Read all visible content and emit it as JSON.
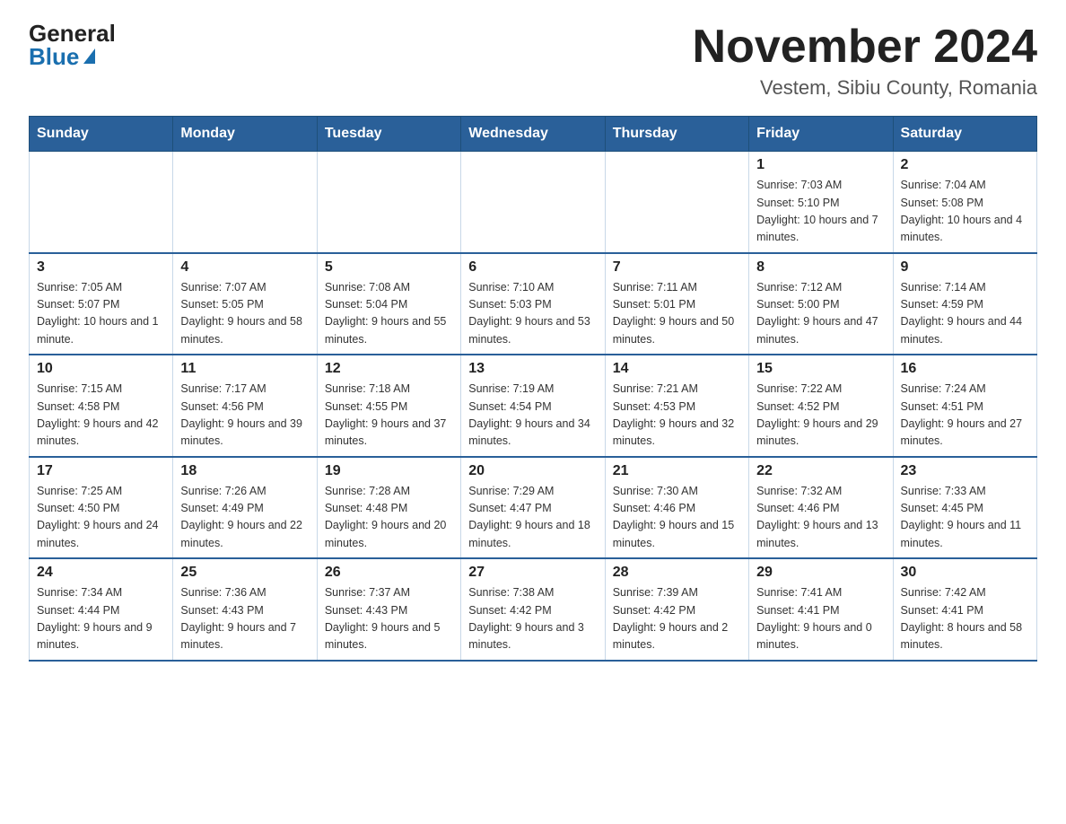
{
  "header": {
    "title": "November 2024",
    "subtitle": "Vestem, Sibiu County, Romania",
    "logo_general": "General",
    "logo_blue": "Blue"
  },
  "weekdays": [
    "Sunday",
    "Monday",
    "Tuesday",
    "Wednesday",
    "Thursday",
    "Friday",
    "Saturday"
  ],
  "weeks": [
    [
      {
        "day": "",
        "info": ""
      },
      {
        "day": "",
        "info": ""
      },
      {
        "day": "",
        "info": ""
      },
      {
        "day": "",
        "info": ""
      },
      {
        "day": "",
        "info": ""
      },
      {
        "day": "1",
        "info": "Sunrise: 7:03 AM\nSunset: 5:10 PM\nDaylight: 10 hours and 7 minutes."
      },
      {
        "day": "2",
        "info": "Sunrise: 7:04 AM\nSunset: 5:08 PM\nDaylight: 10 hours and 4 minutes."
      }
    ],
    [
      {
        "day": "3",
        "info": "Sunrise: 7:05 AM\nSunset: 5:07 PM\nDaylight: 10 hours and 1 minute."
      },
      {
        "day": "4",
        "info": "Sunrise: 7:07 AM\nSunset: 5:05 PM\nDaylight: 9 hours and 58 minutes."
      },
      {
        "day": "5",
        "info": "Sunrise: 7:08 AM\nSunset: 5:04 PM\nDaylight: 9 hours and 55 minutes."
      },
      {
        "day": "6",
        "info": "Sunrise: 7:10 AM\nSunset: 5:03 PM\nDaylight: 9 hours and 53 minutes."
      },
      {
        "day": "7",
        "info": "Sunrise: 7:11 AM\nSunset: 5:01 PM\nDaylight: 9 hours and 50 minutes."
      },
      {
        "day": "8",
        "info": "Sunrise: 7:12 AM\nSunset: 5:00 PM\nDaylight: 9 hours and 47 minutes."
      },
      {
        "day": "9",
        "info": "Sunrise: 7:14 AM\nSunset: 4:59 PM\nDaylight: 9 hours and 44 minutes."
      }
    ],
    [
      {
        "day": "10",
        "info": "Sunrise: 7:15 AM\nSunset: 4:58 PM\nDaylight: 9 hours and 42 minutes."
      },
      {
        "day": "11",
        "info": "Sunrise: 7:17 AM\nSunset: 4:56 PM\nDaylight: 9 hours and 39 minutes."
      },
      {
        "day": "12",
        "info": "Sunrise: 7:18 AM\nSunset: 4:55 PM\nDaylight: 9 hours and 37 minutes."
      },
      {
        "day": "13",
        "info": "Sunrise: 7:19 AM\nSunset: 4:54 PM\nDaylight: 9 hours and 34 minutes."
      },
      {
        "day": "14",
        "info": "Sunrise: 7:21 AM\nSunset: 4:53 PM\nDaylight: 9 hours and 32 minutes."
      },
      {
        "day": "15",
        "info": "Sunrise: 7:22 AM\nSunset: 4:52 PM\nDaylight: 9 hours and 29 minutes."
      },
      {
        "day": "16",
        "info": "Sunrise: 7:24 AM\nSunset: 4:51 PM\nDaylight: 9 hours and 27 minutes."
      }
    ],
    [
      {
        "day": "17",
        "info": "Sunrise: 7:25 AM\nSunset: 4:50 PM\nDaylight: 9 hours and 24 minutes."
      },
      {
        "day": "18",
        "info": "Sunrise: 7:26 AM\nSunset: 4:49 PM\nDaylight: 9 hours and 22 minutes."
      },
      {
        "day": "19",
        "info": "Sunrise: 7:28 AM\nSunset: 4:48 PM\nDaylight: 9 hours and 20 minutes."
      },
      {
        "day": "20",
        "info": "Sunrise: 7:29 AM\nSunset: 4:47 PM\nDaylight: 9 hours and 18 minutes."
      },
      {
        "day": "21",
        "info": "Sunrise: 7:30 AM\nSunset: 4:46 PM\nDaylight: 9 hours and 15 minutes."
      },
      {
        "day": "22",
        "info": "Sunrise: 7:32 AM\nSunset: 4:46 PM\nDaylight: 9 hours and 13 minutes."
      },
      {
        "day": "23",
        "info": "Sunrise: 7:33 AM\nSunset: 4:45 PM\nDaylight: 9 hours and 11 minutes."
      }
    ],
    [
      {
        "day": "24",
        "info": "Sunrise: 7:34 AM\nSunset: 4:44 PM\nDaylight: 9 hours and 9 minutes."
      },
      {
        "day": "25",
        "info": "Sunrise: 7:36 AM\nSunset: 4:43 PM\nDaylight: 9 hours and 7 minutes."
      },
      {
        "day": "26",
        "info": "Sunrise: 7:37 AM\nSunset: 4:43 PM\nDaylight: 9 hours and 5 minutes."
      },
      {
        "day": "27",
        "info": "Sunrise: 7:38 AM\nSunset: 4:42 PM\nDaylight: 9 hours and 3 minutes."
      },
      {
        "day": "28",
        "info": "Sunrise: 7:39 AM\nSunset: 4:42 PM\nDaylight: 9 hours and 2 minutes."
      },
      {
        "day": "29",
        "info": "Sunrise: 7:41 AM\nSunset: 4:41 PM\nDaylight: 9 hours and 0 minutes."
      },
      {
        "day": "30",
        "info": "Sunrise: 7:42 AM\nSunset: 4:41 PM\nDaylight: 8 hours and 58 minutes."
      }
    ]
  ]
}
